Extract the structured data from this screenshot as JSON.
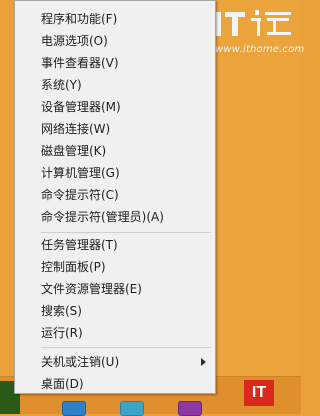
{
  "menu": {
    "items": [
      {
        "label": "程序和功能(F)"
      },
      {
        "label": "电源选项(O)"
      },
      {
        "label": "事件查看器(V)"
      },
      {
        "label": "系统(Y)"
      },
      {
        "label": "设备管理器(M)"
      },
      {
        "label": "网络连接(W)"
      },
      {
        "label": "磁盘管理(K)"
      },
      {
        "label": "计算机管理(G)"
      },
      {
        "label": "命令提示符(C)"
      },
      {
        "label": "命令提示符(管理员)(A)"
      },
      {
        "label": "任务管理器(T)"
      },
      {
        "label": "控制面板(P)"
      },
      {
        "label": "文件资源管理器(E)"
      },
      {
        "label": "搜索(S)"
      },
      {
        "label": "运行(R)"
      },
      {
        "label": "关机或注销(U)"
      },
      {
        "label": "桌面(D)"
      }
    ]
  },
  "watermark": {
    "url": "www.ithome.com"
  },
  "taskbar": {
    "badge": "IT"
  },
  "colors": {
    "desktop": "#eba33c",
    "menu_bg": "#f0f0f0",
    "badge_red": "#d9291a"
  }
}
